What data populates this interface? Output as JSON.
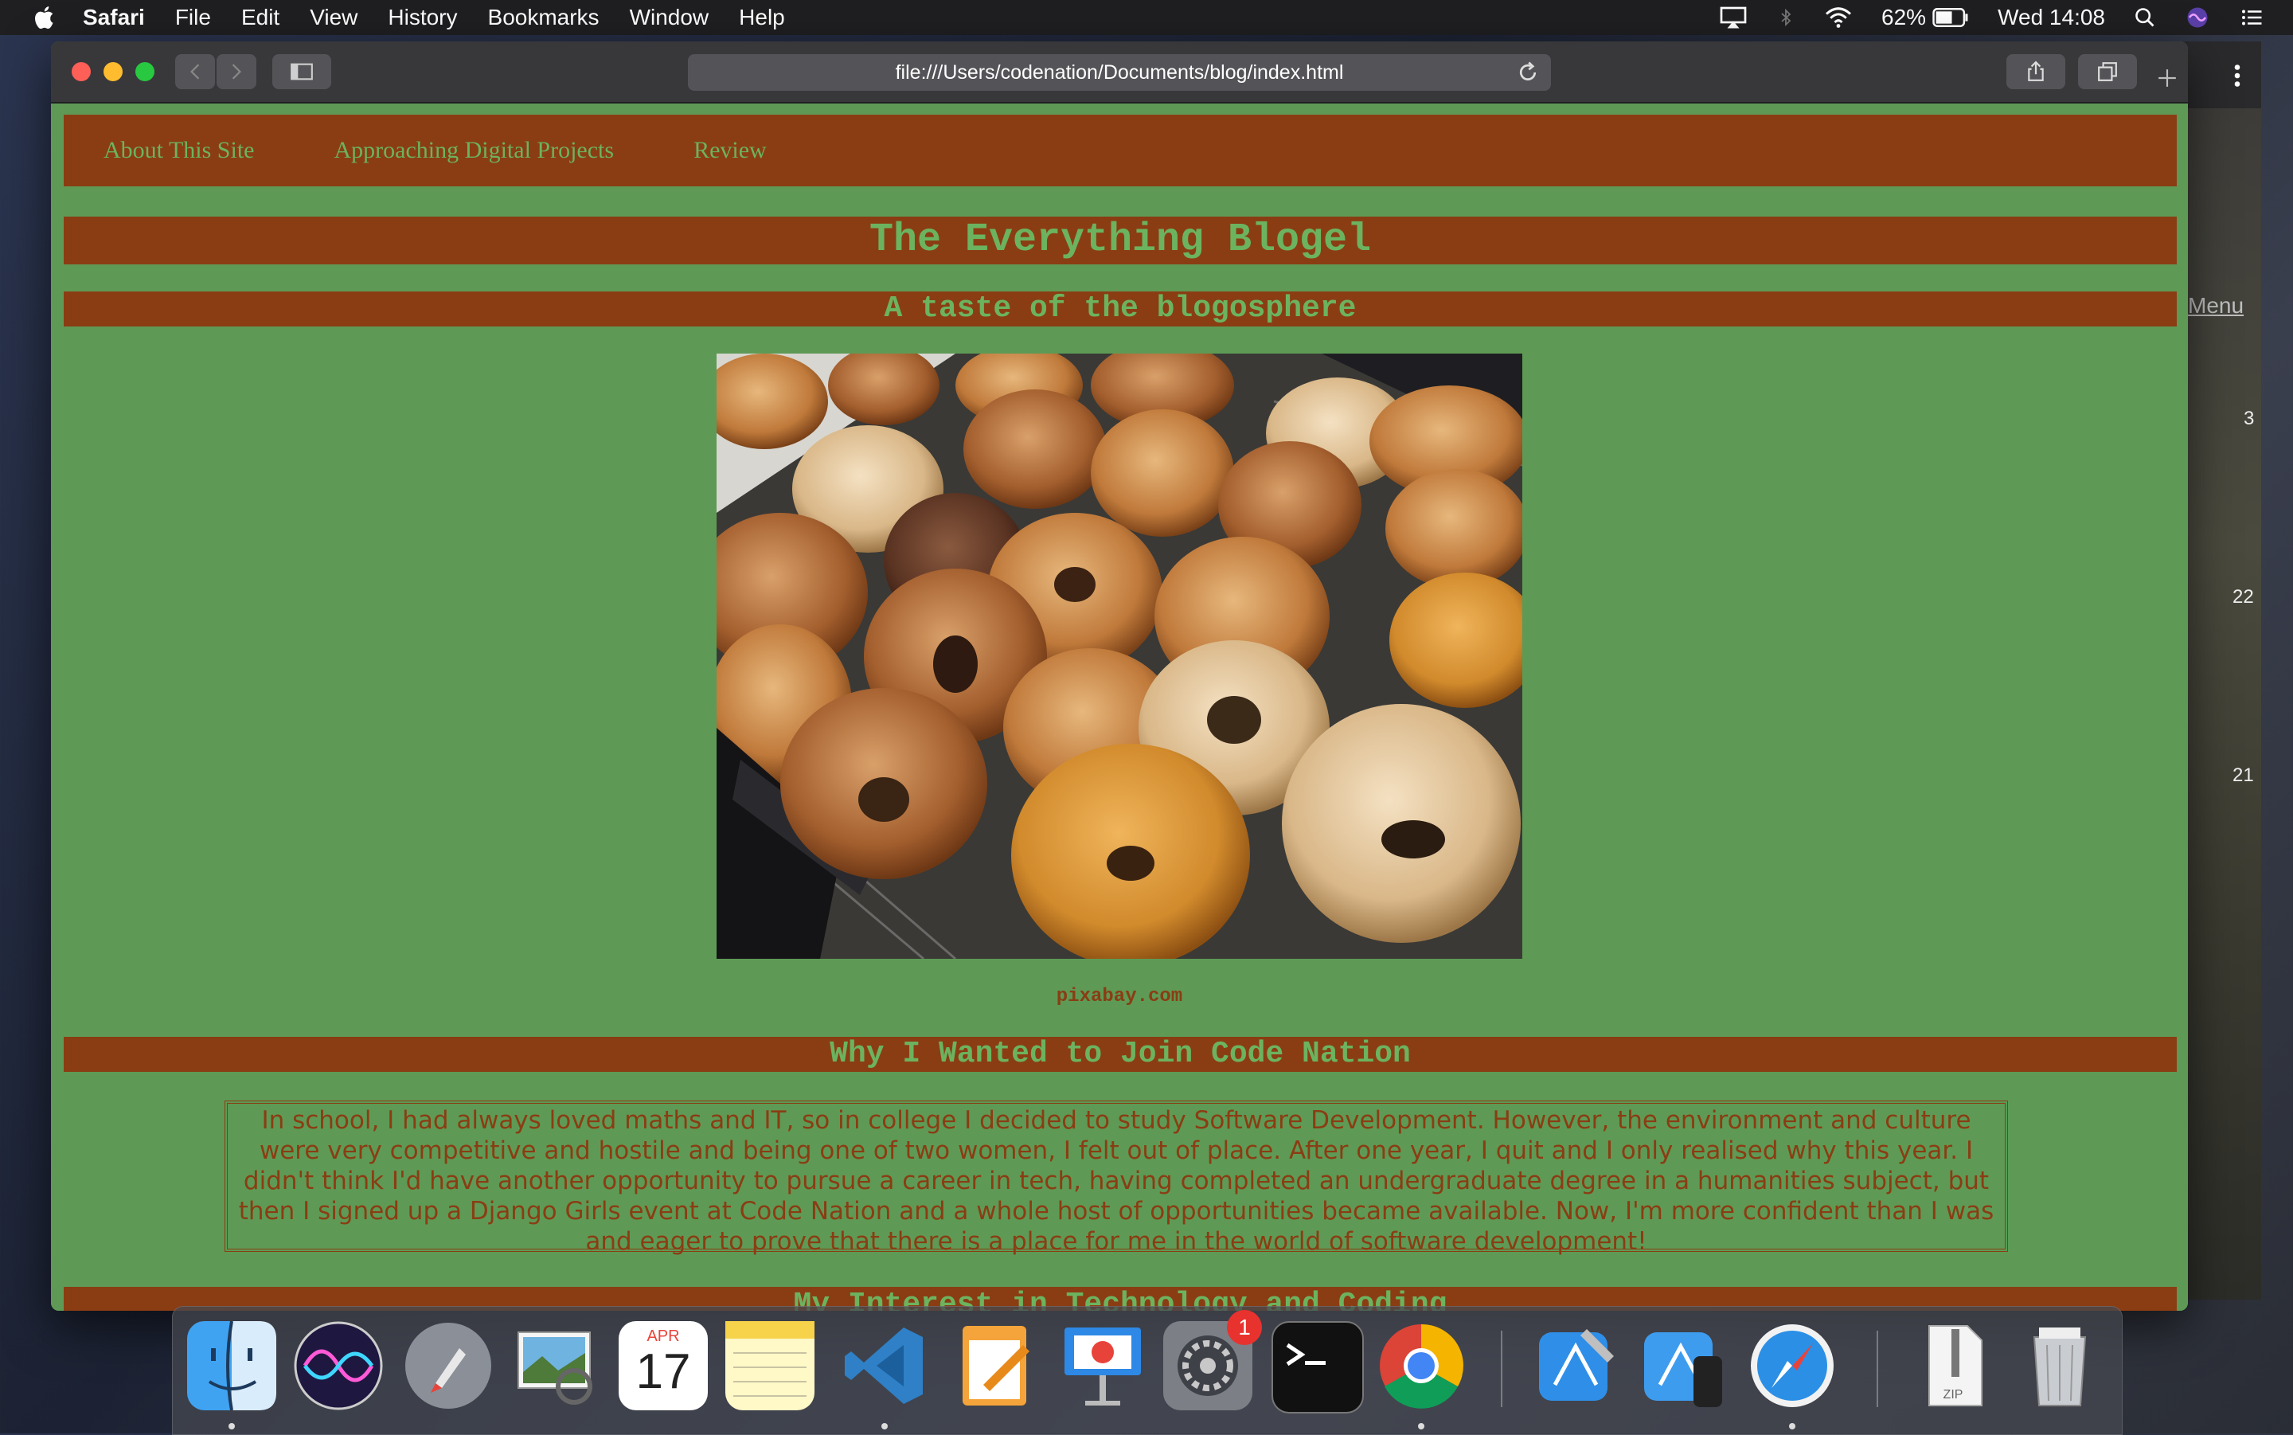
{
  "menubar": {
    "app": "Safari",
    "items": [
      "File",
      "Edit",
      "View",
      "History",
      "Bookmarks",
      "Window",
      "Help"
    ],
    "battery": "62%",
    "clock": "Wed 14:08"
  },
  "browser": {
    "url": "file:///Users/codenation/Documents/blog/index.html"
  },
  "page": {
    "nav": [
      "About This Site",
      "Approaching Digital Projects",
      "Review"
    ],
    "title": "The Everything Blogel",
    "subtitle": "A taste of the blogosphere",
    "image_caption": "pixabay.com",
    "section1_heading": "Why I Wanted to Join Code Nation",
    "section1_text": "In school, I had always loved maths and IT, so in college I decided to study Software Development. However, the environment and culture were very competitive and hostile and being one of two women, I felt out of place. After one year, I quit and I only realised why this year. I didn't think I'd have another opportunity to pursue a career in tech, having completed an undergraduate degree in a humanities subject, but then I signed up a Django Girls event at Code Nation and a whole host of opportunities became available. Now, I'm more confident than I was and eager to prove that there is a place for me in the world of software development!",
    "section2_heading": "My Interest in Technology and Coding"
  },
  "background_window": {
    "menu_link": "Menu",
    "numbers": [
      "3",
      "22",
      "21"
    ]
  },
  "dock": {
    "calendar_month": "APR",
    "calendar_day": "17",
    "settings_badge": "1",
    "zip_label": "ZIP"
  },
  "colors": {
    "page_bg": "#5e9a55",
    "banner_bg": "#8a3d13",
    "banner_text": "#6cb35f"
  }
}
